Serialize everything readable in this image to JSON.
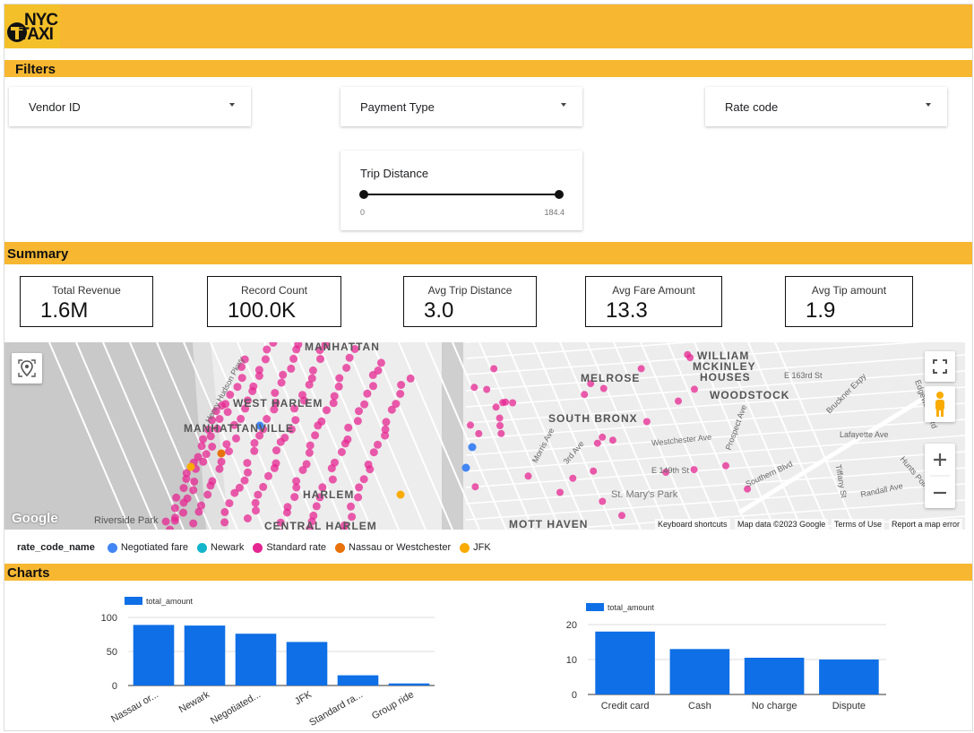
{
  "logo": {
    "line1": "NYC",
    "line2": "TAXI"
  },
  "sections": {
    "filters": "Filters",
    "summary": "Summary",
    "charts": "Charts"
  },
  "filters": {
    "vendor": "Vendor ID",
    "payment": "Payment Type",
    "rate": "Rate code",
    "trip_distance": {
      "title": "Trip Distance",
      "min": "0",
      "max": "184.4"
    }
  },
  "kpis": [
    {
      "title": "Total Revenue",
      "value": "1.6M"
    },
    {
      "title": "Record Count",
      "value": "100.0K"
    },
    {
      "title": "Avg Trip Distance",
      "value": "3.0"
    },
    {
      "title": "Avg Fare Amount",
      "value": "13.3"
    },
    {
      "title": "Avg Tip amount",
      "value": "1.9"
    }
  ],
  "map": {
    "places": [
      "MANHATTAN",
      "WEST HARLEM",
      "MANHATTANVILLE",
      "HARLEM",
      "CENTRAL HARLEM",
      "MELROSE",
      "SOUTH BRONX",
      "WILLIAM",
      "MCKINLEY",
      "HOUSES",
      "WOODSTOCK",
      "MOTT HAVEN"
    ],
    "streets": [
      "Henry Hudson Pkwy",
      "Riverside Park",
      "Westchester Ave",
      "E 163rd St",
      "Bruckner Expy",
      "Lafayette Ave",
      "Randall Ave",
      "Southern Blvd",
      "St. Mary's Park",
      "Morris Ave",
      "3rd Ave",
      "E 149th St",
      "Edgewater Rd",
      "Tiffany St",
      "Prospect Ave",
      "Hunts Point Ave"
    ],
    "google": "Google",
    "footer": [
      "Keyboard shortcuts",
      "Map data ©2023 Google",
      "Terms of Use",
      "Report a map error"
    ],
    "dot_color": "#e6199a",
    "water_color": "#c8c8c8"
  },
  "legend": {
    "title": "rate_code_name",
    "items": [
      {
        "label": "Negotiated fare",
        "color": "#4285f4"
      },
      {
        "label": "Newark",
        "color": "#12b5cb"
      },
      {
        "label": "Standard rate",
        "color": "#e52592"
      },
      {
        "label": "Nassau or Westchester",
        "color": "#e8710a"
      },
      {
        "label": "JFK",
        "color": "#f9ab00"
      }
    ]
  },
  "chart_data": [
    {
      "type": "bar",
      "series": [
        {
          "name": "total_amount",
          "values": [
            89,
            88,
            76,
            64,
            15,
            3
          ]
        }
      ],
      "categories": [
        "Nassau or...",
        "Newark",
        "Negotiated...",
        "JFK",
        "Standard ra...",
        "Group ride"
      ],
      "ylim": [
        0,
        100
      ],
      "yticks": [
        0,
        50,
        100
      ],
      "color": "#0f6fe6"
    },
    {
      "type": "bar",
      "series": [
        {
          "name": "total_amount",
          "values": [
            18,
            13,
            10.5,
            10
          ]
        }
      ],
      "categories": [
        "Credit card",
        "Cash",
        "No charge",
        "Dispute"
      ],
      "ylim": [
        0,
        20
      ],
      "yticks": [
        0,
        10,
        20
      ],
      "color": "#0f6fe6"
    }
  ]
}
